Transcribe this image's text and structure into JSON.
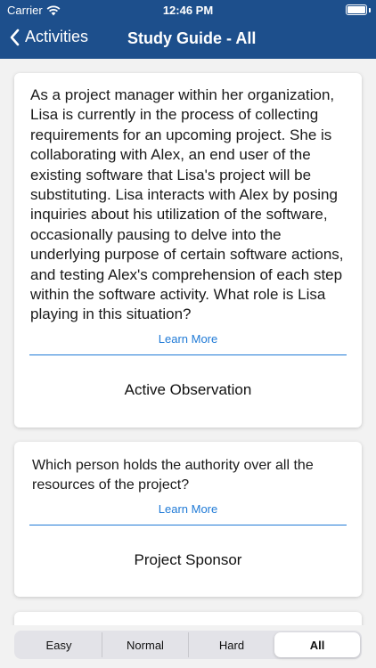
{
  "status": {
    "carrier": "Carrier",
    "time": "12:46 PM"
  },
  "nav": {
    "back_label": "Activities",
    "title": "Study Guide - All"
  },
  "cards": [
    {
      "question": "As a project manager within her organization, Lisa is currently in the process of collecting requirements for an upcoming project. She is collaborating with Alex, an end user of the existing software that Lisa's project will be substituting. Lisa interacts with Alex by posing inquiries about his utilization of the software, occasionally pausing to delve into the underlying purpose of certain software actions, and testing Alex's comprehension of each step within the software activity. What role is Lisa playing in this situation?",
      "learn_more": "Learn More",
      "answer": "Active Observation"
    },
    {
      "question": "Which person holds the authority over all the resources of the project?",
      "learn_more": "Learn More",
      "answer": "Project Sponsor"
    }
  ],
  "segments": [
    {
      "label": "Easy"
    },
    {
      "label": "Normal"
    },
    {
      "label": "Hard"
    },
    {
      "label": "All",
      "selected": true
    }
  ],
  "colors": {
    "header": "#1d4f8c",
    "accent": "#1f7ad6"
  }
}
